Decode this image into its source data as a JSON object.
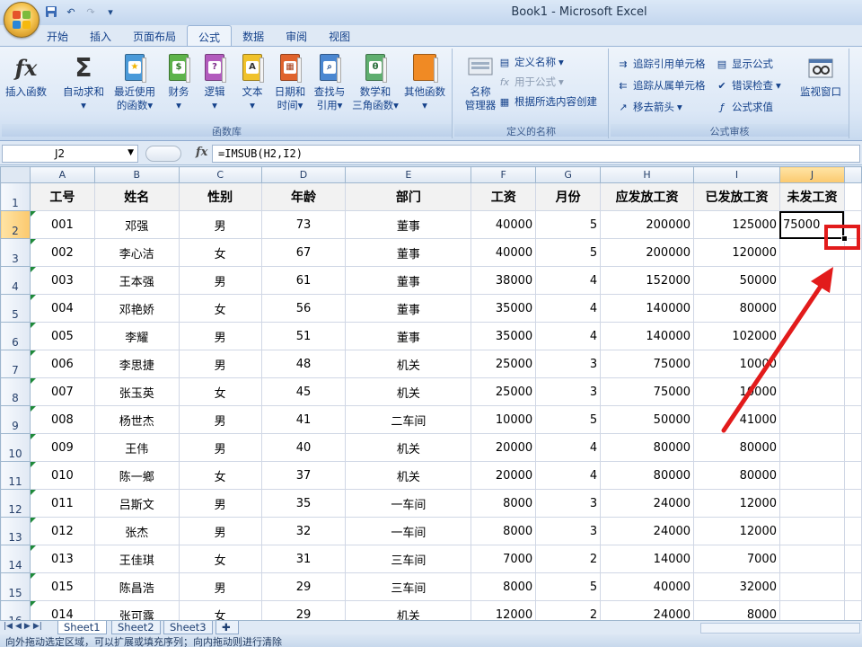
{
  "window": {
    "title": "Book1 - Microsoft Excel"
  },
  "tabs": [
    "开始",
    "插入",
    "页面布局",
    "公式",
    "数据",
    "审阅",
    "视图"
  ],
  "active_tab": "公式",
  "ribbon": {
    "function_library": {
      "label": "函数库",
      "insert_function": "插入函数",
      "autosum": "自动求和",
      "recent": [
        "最近使用",
        "的函数"
      ],
      "financial": "财务",
      "logical": "逻辑",
      "text": "文本",
      "datetime": [
        "日期和",
        "时间"
      ],
      "lookup": [
        "查找与",
        "引用"
      ],
      "math": [
        "数学和",
        "三角函数"
      ],
      "more": "其他函数"
    },
    "defined_names": {
      "label": "定义的名称",
      "name_manager": [
        "名称",
        "管理器"
      ],
      "define_name": "定义名称",
      "use_in_formula": "用于公式",
      "create_from_selection": "根据所选内容创建"
    },
    "formula_auditing": {
      "label": "公式审核",
      "trace_precedents": "追踪引用单元格",
      "trace_dependents": "追踪从属单元格",
      "remove_arrows": "移去箭头",
      "show_formulas": "显示公式",
      "error_checking": "错误检查",
      "evaluate_formula": "公式求值",
      "watch_window": "监视窗口"
    }
  },
  "formula_bar": {
    "name_box": "J2",
    "fx": "fx",
    "formula": "=IMSUB(H2,I2)"
  },
  "columns": [
    "A",
    "B",
    "C",
    "D",
    "E",
    "F",
    "G",
    "H",
    "I",
    "J"
  ],
  "row_numbers": [
    "1",
    "2",
    "3",
    "4",
    "5",
    "6",
    "7",
    "8",
    "9",
    "10",
    "11",
    "12",
    "13",
    "14",
    "15",
    "16"
  ],
  "headers": [
    "工号",
    "姓名",
    "性别",
    "年龄",
    "部门",
    "工资",
    "月份",
    "应发放工资",
    "已发放工资",
    "未发工资"
  ],
  "rows": [
    [
      "001",
      "邓强",
      "男",
      "73",
      "董事",
      "40000",
      "5",
      "200000",
      "125000",
      "75000"
    ],
    [
      "002",
      "李心洁",
      "女",
      "67",
      "董事",
      "40000",
      "5",
      "200000",
      "120000",
      ""
    ],
    [
      "003",
      "王本强",
      "男",
      "61",
      "董事",
      "38000",
      "4",
      "152000",
      "50000",
      ""
    ],
    [
      "004",
      "邓艳娇",
      "女",
      "56",
      "董事",
      "35000",
      "4",
      "140000",
      "80000",
      ""
    ],
    [
      "005",
      "李耀",
      "男",
      "51",
      "董事",
      "35000",
      "4",
      "140000",
      "102000",
      ""
    ],
    [
      "006",
      "李思捷",
      "男",
      "48",
      "机关",
      "25000",
      "3",
      "75000",
      "10000",
      ""
    ],
    [
      "007",
      "张玉英",
      "女",
      "45",
      "机关",
      "25000",
      "3",
      "75000",
      "10000",
      ""
    ],
    [
      "008",
      "杨世杰",
      "男",
      "41",
      "二车间",
      "10000",
      "5",
      "50000",
      "41000",
      ""
    ],
    [
      "009",
      "王伟",
      "男",
      "40",
      "机关",
      "20000",
      "4",
      "80000",
      "80000",
      ""
    ],
    [
      "010",
      "陈一鄉",
      "女",
      "37",
      "机关",
      "20000",
      "4",
      "80000",
      "80000",
      ""
    ],
    [
      "011",
      "吕斯文",
      "男",
      "35",
      "一车间",
      "8000",
      "3",
      "24000",
      "12000",
      ""
    ],
    [
      "012",
      "张杰",
      "男",
      "32",
      "一车间",
      "8000",
      "3",
      "24000",
      "12000",
      ""
    ],
    [
      "013",
      "王佳琪",
      "女",
      "31",
      "三车间",
      "7000",
      "2",
      "14000",
      "7000",
      ""
    ],
    [
      "015",
      "陈昌浩",
      "男",
      "29",
      "三车间",
      "8000",
      "5",
      "40000",
      "32000",
      ""
    ],
    [
      "014",
      "张可露",
      "女",
      "29",
      "机关",
      "12000",
      "2",
      "24000",
      "8000",
      ""
    ]
  ],
  "sheet_tabs": [
    "Sheet1",
    "Sheet2",
    "Sheet3"
  ],
  "status": "向外拖动选定区域，可以扩展或填充序列；向内拖动则进行清除",
  "colors": {
    "annotation": "#e21b1b",
    "header_fill": "#f2f2f2",
    "active_header": "#fbc96e"
  }
}
